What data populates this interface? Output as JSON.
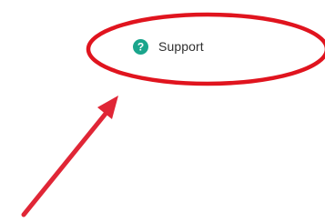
{
  "menu": {
    "support_label": "Support",
    "support_icon": "help-circle-icon",
    "icon_color": "#1aa58c"
  },
  "annotations": {
    "highlight_shape": "ellipse",
    "highlight_color": "#e0141e",
    "arrow_color": "#e02636"
  }
}
